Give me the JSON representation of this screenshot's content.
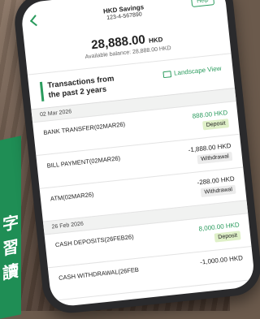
{
  "background": {
    "banner_chars": [
      "字",
      "習",
      "讀"
    ]
  },
  "header": {
    "account_name": "HKD Savings",
    "account_number": "123-4-567890",
    "help_label": "Help"
  },
  "balance": {
    "amount": "28,888.00",
    "currency": "HKD",
    "available": "Available balance: 28,888.00 HKD"
  },
  "section": {
    "title": "Transactions from the past 2 years",
    "landscape_label": "Landscape View"
  },
  "groups": [
    {
      "date": "02 Mar 2026",
      "transactions": [
        {
          "desc": "BANK TRANSFER(02MAR26)",
          "amount": "888.00 HKD",
          "type": "Deposit"
        },
        {
          "desc": "BILL PAYMENT(02MAR26)",
          "amount": "-1,888.00 HKD",
          "type": "Withdrawal"
        },
        {
          "desc": "ATM(02MAR26)",
          "amount": "-288.00 HKD",
          "type": "Withdrawal"
        }
      ]
    },
    {
      "date": "26 Feb 2026",
      "transactions": [
        {
          "desc": "CASH DEPOSITS(26FEB26)",
          "amount": "8,000.00 HKD",
          "type": "Deposit"
        },
        {
          "desc": "CASH WITHDRAWAL(26FEB",
          "amount": "-1,000.00 HKD",
          "type": ""
        }
      ]
    }
  ],
  "colors": {
    "accent": "#2a9b5d",
    "deposit_badge": "#dff0c8",
    "withdrawal_badge": "#ececec"
  }
}
